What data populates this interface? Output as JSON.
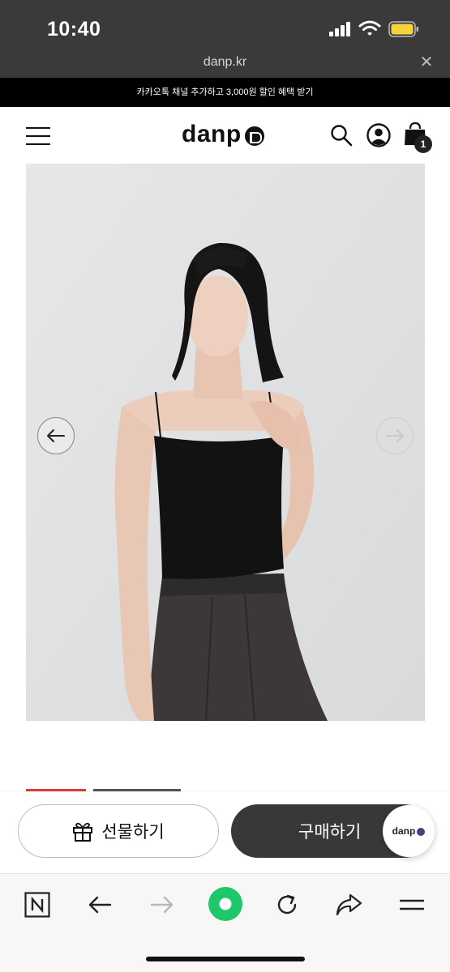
{
  "status_bar": {
    "time": "10:40",
    "icons": [
      "cellular-signal-icon",
      "wifi-icon",
      "battery-icon"
    ],
    "battery_color": "#f5d33a"
  },
  "browser": {
    "url": "danp.kr",
    "close_icon": "close-icon",
    "toolbar_icons": [
      "naver-n-icon",
      "back-arrow-icon",
      "forward-arrow-icon",
      "green-home-icon",
      "reload-icon",
      "share-icon",
      "menu-icon"
    ],
    "accent_green": "#1ec86a"
  },
  "promo": {
    "text": "카카오톡 채널 추가하고 3,000원 할인 혜택 받기"
  },
  "header": {
    "logo_text": "danp",
    "cart_count": "1",
    "icons": [
      "hamburger-menu-icon",
      "search-icon",
      "account-icon",
      "shopping-bag-icon"
    ]
  },
  "product": {
    "image_alt": "model wearing black camisole and charcoal pleated trousers",
    "prev_icon": "arrow-left-icon",
    "next_icon": "arrow-right-icon",
    "indicator_active_color": "#e23b3b",
    "indicator_color": "#555555"
  },
  "cta": {
    "gift_label": "선물하기",
    "buy_label": "구매하기",
    "chat_label": "danp"
  }
}
